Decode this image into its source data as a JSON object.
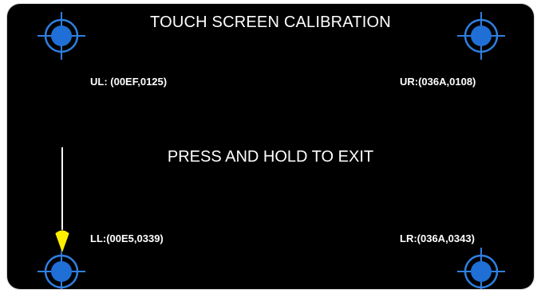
{
  "title": "TOUCH SCREEN CALIBRATION",
  "center_message": "PRESS AND HOLD TO EXIT",
  "corners": {
    "ul": "UL: (00EF,0125)",
    "ur": "UR:(036A,0108)",
    "ll": "LL:(00E5,0339)",
    "lr": "LR:(036A,0343)"
  },
  "colors": {
    "background": "#000000",
    "target_fill": "#1f6fd6",
    "target_ring": "#2f7fe0",
    "pointer": "#ffee00",
    "text": "#ffffff"
  },
  "icons": {
    "target": "crosshair-target-icon",
    "pointer": "stylus-pointer-icon"
  }
}
